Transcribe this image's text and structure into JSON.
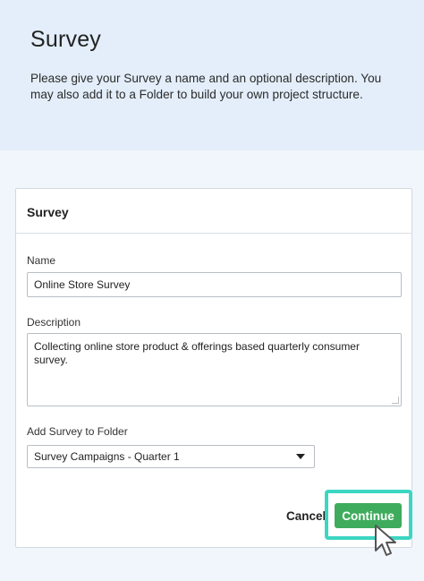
{
  "header": {
    "title": "Survey",
    "description": "Please give your Survey a name and an optional description. You may also add it to a Folder to build your own project structure."
  },
  "card": {
    "title": "Survey",
    "name_label": "Name",
    "name_value": "Online Store Survey",
    "description_label": "Description",
    "description_value": "Collecting online store product & offerings based quarterly consumer survey.",
    "folder_label": "Add Survey to Folder",
    "folder_value": "Survey Campaigns - Quarter 1",
    "cancel_label": "Cancel",
    "continue_label": "Continue"
  },
  "colors": {
    "header_bg": "#e3eefa",
    "continue_bg": "#3eac5c",
    "highlight": "#3cd6c2"
  },
  "icons": {
    "cursor": "mouse-pointer-icon",
    "dropdown": "caret-down-icon"
  }
}
